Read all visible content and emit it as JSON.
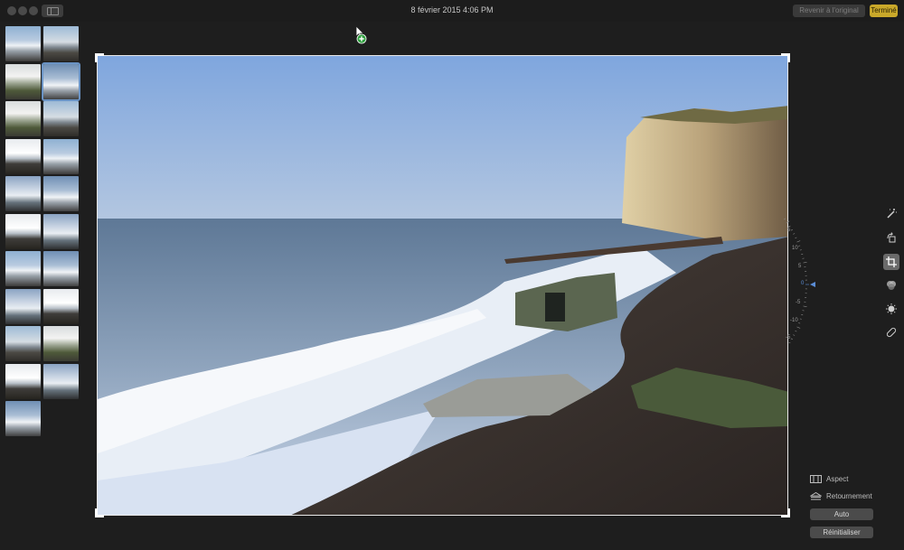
{
  "window": {
    "title": "8 février 2015 4:06 PM",
    "revert_label": "Revenir à l'original",
    "done_label": "Terminé"
  },
  "thumbnails": [
    {
      "style": "t-a"
    },
    {
      "style": "t-b"
    },
    {
      "style": "t-c"
    },
    {
      "style": "t-f",
      "selected": true
    },
    {
      "style": "t-c"
    },
    {
      "style": "t-b"
    },
    {
      "style": "t-d"
    },
    {
      "style": "t-a"
    },
    {
      "style": "t-e"
    },
    {
      "style": "t-f"
    },
    {
      "style": "t-d"
    },
    {
      "style": "t-e"
    },
    {
      "style": "t-a"
    },
    {
      "style": "t-f"
    },
    {
      "style": "t-e"
    },
    {
      "style": "t-d"
    },
    {
      "style": "t-b"
    },
    {
      "style": "t-c"
    },
    {
      "style": "t-d"
    },
    {
      "style": "t-e"
    },
    {
      "style": "t-f"
    }
  ],
  "dial": {
    "labels": [
      "5",
      "10",
      "5",
      "-5",
      "-10",
      "-5"
    ],
    "zero_label": "0"
  },
  "tools": [
    {
      "name": "enhance-icon"
    },
    {
      "name": "rotate-icon"
    },
    {
      "name": "crop-icon",
      "active": true
    },
    {
      "name": "filters-icon"
    },
    {
      "name": "adjust-icon"
    },
    {
      "name": "retouch-icon"
    }
  ],
  "crop_options": {
    "aspect_label": "Aspect",
    "flip_label": "Retournement",
    "auto_label": "Auto",
    "reset_label": "Réinitialiser"
  },
  "colors": {
    "accent_done": "#c9a82a",
    "selection": "#6a93c4",
    "dial_zero": "#5b8dd6"
  }
}
